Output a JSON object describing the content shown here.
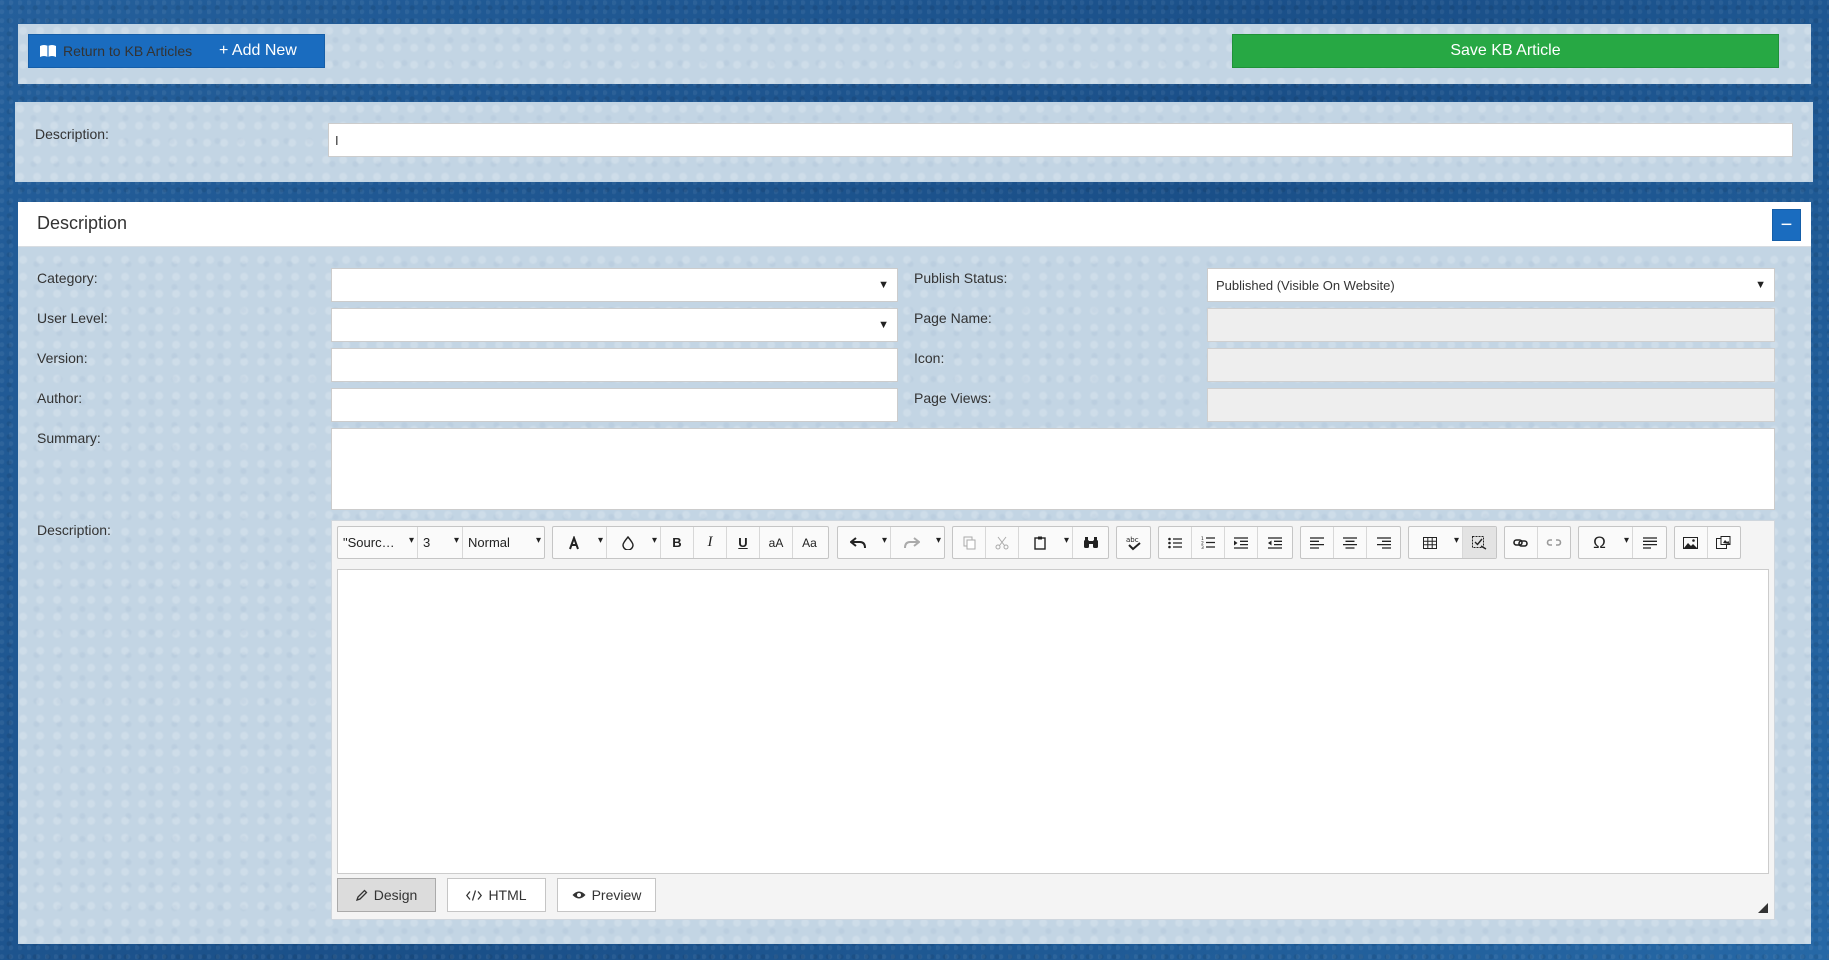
{
  "toolbar": {
    "return_label": "Return to KB Articles",
    "add_new_label": "+ Add New",
    "save_label": "Save KB Article"
  },
  "description_row": {
    "label": "Description:",
    "value": "I"
  },
  "card": {
    "title": "Description",
    "collapse_symbol": "−"
  },
  "form": {
    "category": {
      "label": "Category:",
      "value": ""
    },
    "user_level": {
      "label": "User Level:",
      "value": ""
    },
    "version": {
      "label": "Version:",
      "value": ""
    },
    "author": {
      "label": "Author:",
      "value": ""
    },
    "summary": {
      "label": "Summary:",
      "value": ""
    },
    "publish_status": {
      "label": "Publish Status:",
      "value": "Published (Visible On Website)"
    },
    "page_name": {
      "label": "Page Name:",
      "value": ""
    },
    "icon": {
      "label": "Icon:",
      "value": ""
    },
    "page_views": {
      "label": "Page Views:",
      "value": ""
    },
    "description": {
      "label": "Description:"
    }
  },
  "editor": {
    "font_name": "\"Sourc…",
    "font_size": "3",
    "format": "Normal",
    "bold": "B",
    "italic": "I",
    "underline": "U",
    "lowercase": "aA",
    "case": "Aa",
    "modes": {
      "design": "Design",
      "html": "HTML",
      "preview": "Preview"
    }
  },
  "colors": {
    "primary": "#1a6cbf",
    "success": "#27a844",
    "page_bg": "#1f5a96",
    "panel_bg": "#c3d5e4"
  },
  "icons": [
    "book-icon",
    "minus-icon",
    "font-color-icon",
    "highlight-icon",
    "undo-icon",
    "redo-icon",
    "copy-icon",
    "cut-icon",
    "paste-icon",
    "find-icon",
    "spellcheck-icon",
    "bullet-list-icon",
    "numbered-list-icon",
    "indent-icon",
    "outdent-icon",
    "align-left-icon",
    "align-center-icon",
    "align-right-icon",
    "table-icon",
    "show-formatting-icon",
    "link-icon",
    "unlink-icon",
    "special-char-icon",
    "paragraph-icon",
    "image-icon",
    "media-icon",
    "pencil-icon",
    "code-icon",
    "eye-icon"
  ]
}
